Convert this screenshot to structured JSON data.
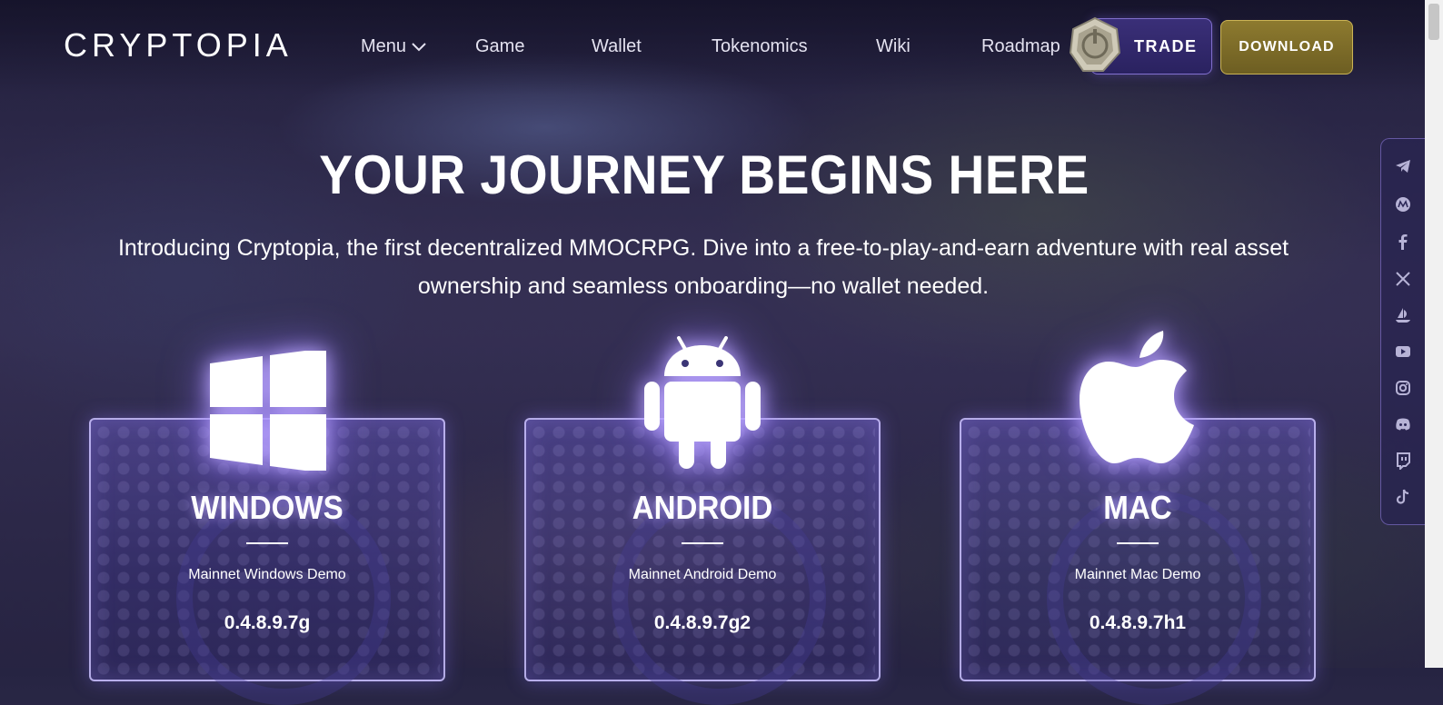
{
  "header": {
    "logo_text": "CRYPTOPIA",
    "nav": [
      {
        "label": "Menu"
      },
      {
        "label": "Game"
      },
      {
        "label": "Wallet"
      },
      {
        "label": "Tokenomics"
      },
      {
        "label": "Wiki"
      },
      {
        "label": "Roadmap"
      }
    ],
    "trade_label": "TRADE",
    "download_label": "DOWNLOAD"
  },
  "hero": {
    "title": "YOUR JOURNEY BEGINS HERE",
    "subtitle_line1": "Introducing Cryptopia, the first decentralized MMOCRPG. Dive into a free-to-play-and-earn adventure with real asset",
    "subtitle_line2": "ownership and seamless onboarding—no wallet needed."
  },
  "social": [
    {
      "icon": "telegram-icon"
    },
    {
      "icon": "medium-icon"
    },
    {
      "icon": "facebook-icon"
    },
    {
      "icon": "x-icon"
    },
    {
      "icon": "opensea-icon"
    },
    {
      "icon": "youtube-icon"
    },
    {
      "icon": "instagram-icon"
    },
    {
      "icon": "discord-icon"
    },
    {
      "icon": "twitch-icon"
    },
    {
      "icon": "tiktok-icon"
    }
  ],
  "cards": [
    {
      "platform": "WINDOWS",
      "demo": "Mainnet Windows Demo",
      "version": "0.4.8.9.7g"
    },
    {
      "platform": "ANDROID",
      "demo": "Mainnet Android Demo",
      "version": "0.4.8.9.7g2"
    },
    {
      "platform": "MAC",
      "demo": "Mainnet Mac Demo",
      "version": "0.4.8.9.7h1"
    }
  ],
  "colors": {
    "accent_purple": "#8f7cf0",
    "download_gold": "#8d7a2f",
    "trade_purple": "#3a2f78"
  }
}
